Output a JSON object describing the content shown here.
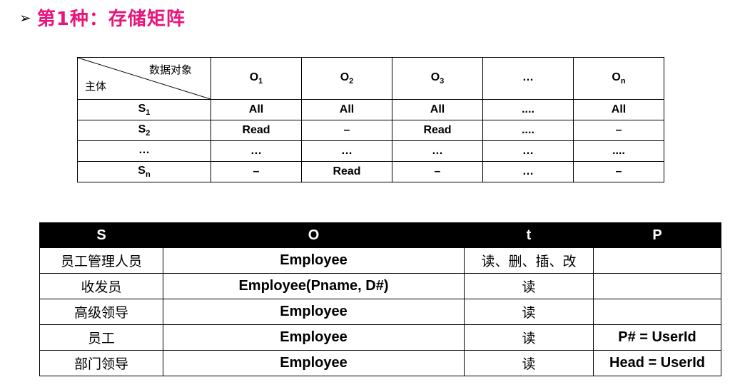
{
  "heading": {
    "bullet": "➢",
    "title": "第1种：存储矩阵"
  },
  "matrix": {
    "corner_object_label": "数据对象",
    "corner_subject_label": "主体",
    "columns": [
      {
        "base": "O",
        "sub": "1"
      },
      {
        "base": "O",
        "sub": "2"
      },
      {
        "base": "O",
        "sub": "3"
      },
      {
        "base": "…",
        "sub": ""
      },
      {
        "base": "O",
        "sub": "n"
      }
    ],
    "rows": [
      {
        "subject": {
          "base": "S",
          "sub": "1"
        },
        "cells": [
          "All",
          "All",
          "All",
          "....",
          "All"
        ]
      },
      {
        "subject": {
          "base": "S",
          "sub": "2"
        },
        "cells": [
          "Read",
          "–",
          "Read",
          "....",
          "–"
        ]
      },
      {
        "subject": {
          "base": "…",
          "sub": ""
        },
        "cells": [
          "…",
          "…",
          "…",
          "…",
          "...."
        ]
      },
      {
        "subject": {
          "base": "S",
          "sub": "n"
        },
        "cells": [
          "–",
          "Read",
          "–",
          "…",
          "–"
        ]
      }
    ]
  },
  "permissions": {
    "headers": [
      "S",
      "O",
      "t",
      "P"
    ],
    "rows": [
      {
        "s": "员工管理人员",
        "o": "Employee",
        "t": "读、删、插、改",
        "p": ""
      },
      {
        "s": "收发员",
        "o": "Employee(Pname, D#)",
        "t": "读",
        "p": ""
      },
      {
        "s": "高级领导",
        "o": "Employee",
        "t": "读",
        "p": ""
      },
      {
        "s": "员工",
        "o": "Employee",
        "t": "读",
        "p": "P# = UserId"
      },
      {
        "s": "部门领导",
        "o": "Employee",
        "t": "读",
        "p": "Head = UserId"
      }
    ]
  }
}
